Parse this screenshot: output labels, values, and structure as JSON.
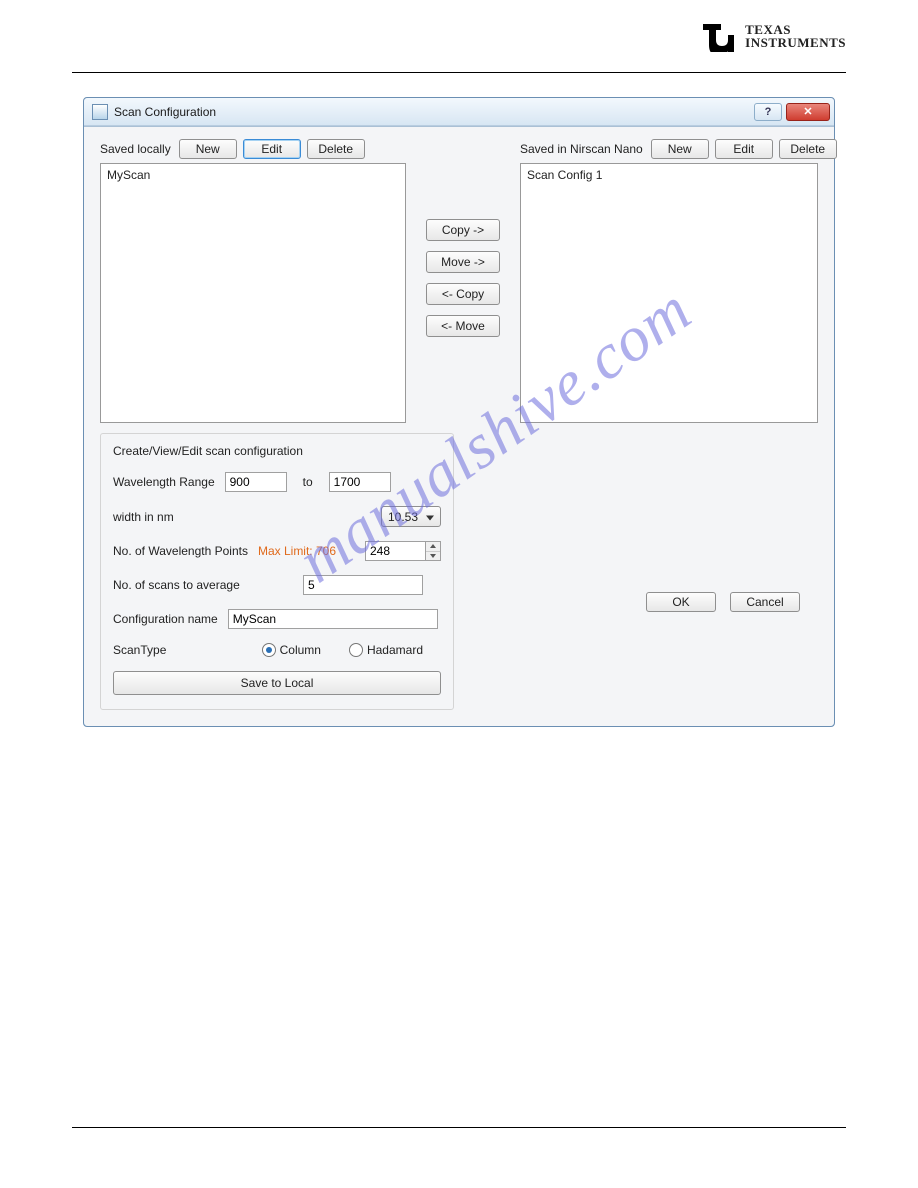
{
  "brand": {
    "line1": "TEXAS",
    "line2": "INSTRUMENTS"
  },
  "window": {
    "title": "Scan Configuration",
    "help": "?"
  },
  "left": {
    "label": "Saved locally",
    "new": "New",
    "edit": "Edit",
    "del": "Delete",
    "item": "MyScan"
  },
  "mid": {
    "copyR": "Copy ->",
    "moveR": "Move ->",
    "copyL": "<- Copy",
    "moveL": "<- Move"
  },
  "right": {
    "label": "Saved in Nirscan Nano",
    "new": "New",
    "edit": "Edit",
    "del": "Delete",
    "item": "Scan Config 1"
  },
  "form": {
    "panelTitle": "Create/View/Edit  scan configuration",
    "wlRange": "Wavelength Range",
    "wlFrom": "900",
    "to": "to",
    "wlTo": "1700",
    "widthLabel": "width in nm",
    "widthValue": "10.53",
    "nPointsLabel": "No. of Wavelength Points",
    "maxLimit": "Max Limit: 706",
    "nPointsValue": "248",
    "nAvgLabel": "No. of scans to average",
    "nAvgValue": "5",
    "cfgNameLabel": "Configuration name",
    "cfgNameValue": "MyScan",
    "scanTypeLabel": "ScanType",
    "column": "Column",
    "hadamard": "Hadamard",
    "save": "Save to Local"
  },
  "actions": {
    "ok": "OK",
    "cancel": "Cancel"
  },
  "watermark": "manualshive.com"
}
